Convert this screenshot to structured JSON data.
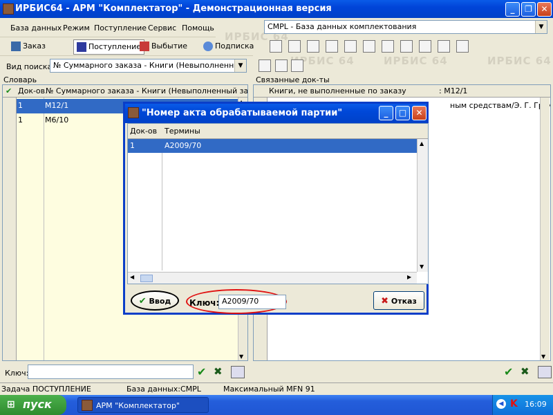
{
  "window": {
    "title": "ИРБИС64 - АРМ \"Комплектатор\" - Демонстрационная версия"
  },
  "menu": {
    "items": [
      "База данных",
      "Режим",
      "Поступление",
      "Сервис",
      "Помощь"
    ]
  },
  "database_select": {
    "value": "CMPL - База данных комплектования"
  },
  "toolbar": {
    "buttons": [
      "Заказ",
      "Поступление",
      "Выбытие",
      "Подписка"
    ]
  },
  "watermark": "ИРБИС 64",
  "search": {
    "label": "Вид поиска",
    "value": "№ Суммарного заказа - Книги (Невыполненный зак"
  },
  "left_panel": {
    "title": "Словарь",
    "columns": [
      "Док-ов",
      "№ Суммарного заказа - Книги (Невыполненный заказ"
    ],
    "rows": [
      {
        "count": "1",
        "term": "M12/1"
      },
      {
        "count": "1",
        "term": "M6/10"
      }
    ],
    "key_label": "Ключ:"
  },
  "right_panel": {
    "title": "Связанные док-ты",
    "header": "Книги, не выполненные по заказу",
    "header_value": ": M12/1",
    "row_partial": "ным средствам/Э. Г. Громов"
  },
  "dialog": {
    "title": "\"Номер акта обрабатываемой партии\"",
    "columns": [
      "Док-ов",
      "Термины"
    ],
    "rows": [
      {
        "count": "1",
        "term": "A2009/70"
      }
    ],
    "ok_label": "Ввод",
    "key_label": "Ключ:",
    "key_value": "A2009/70",
    "cancel_label": "Отказ"
  },
  "statusbar": {
    "task": "Задача ПОСТУПЛЕНИЕ",
    "database": "База данных:CMPL",
    "mfn": "Максимальный MFN 91"
  },
  "taskbar": {
    "start_label": "пуск",
    "task_label": "АРМ \"Комплектатор\"",
    "clock": "16:09"
  },
  "colors": {
    "title_bar": "#0a5be8",
    "selection": "#316ac5",
    "highlight_row": "#fefde0",
    "annotation": "#e01010"
  }
}
